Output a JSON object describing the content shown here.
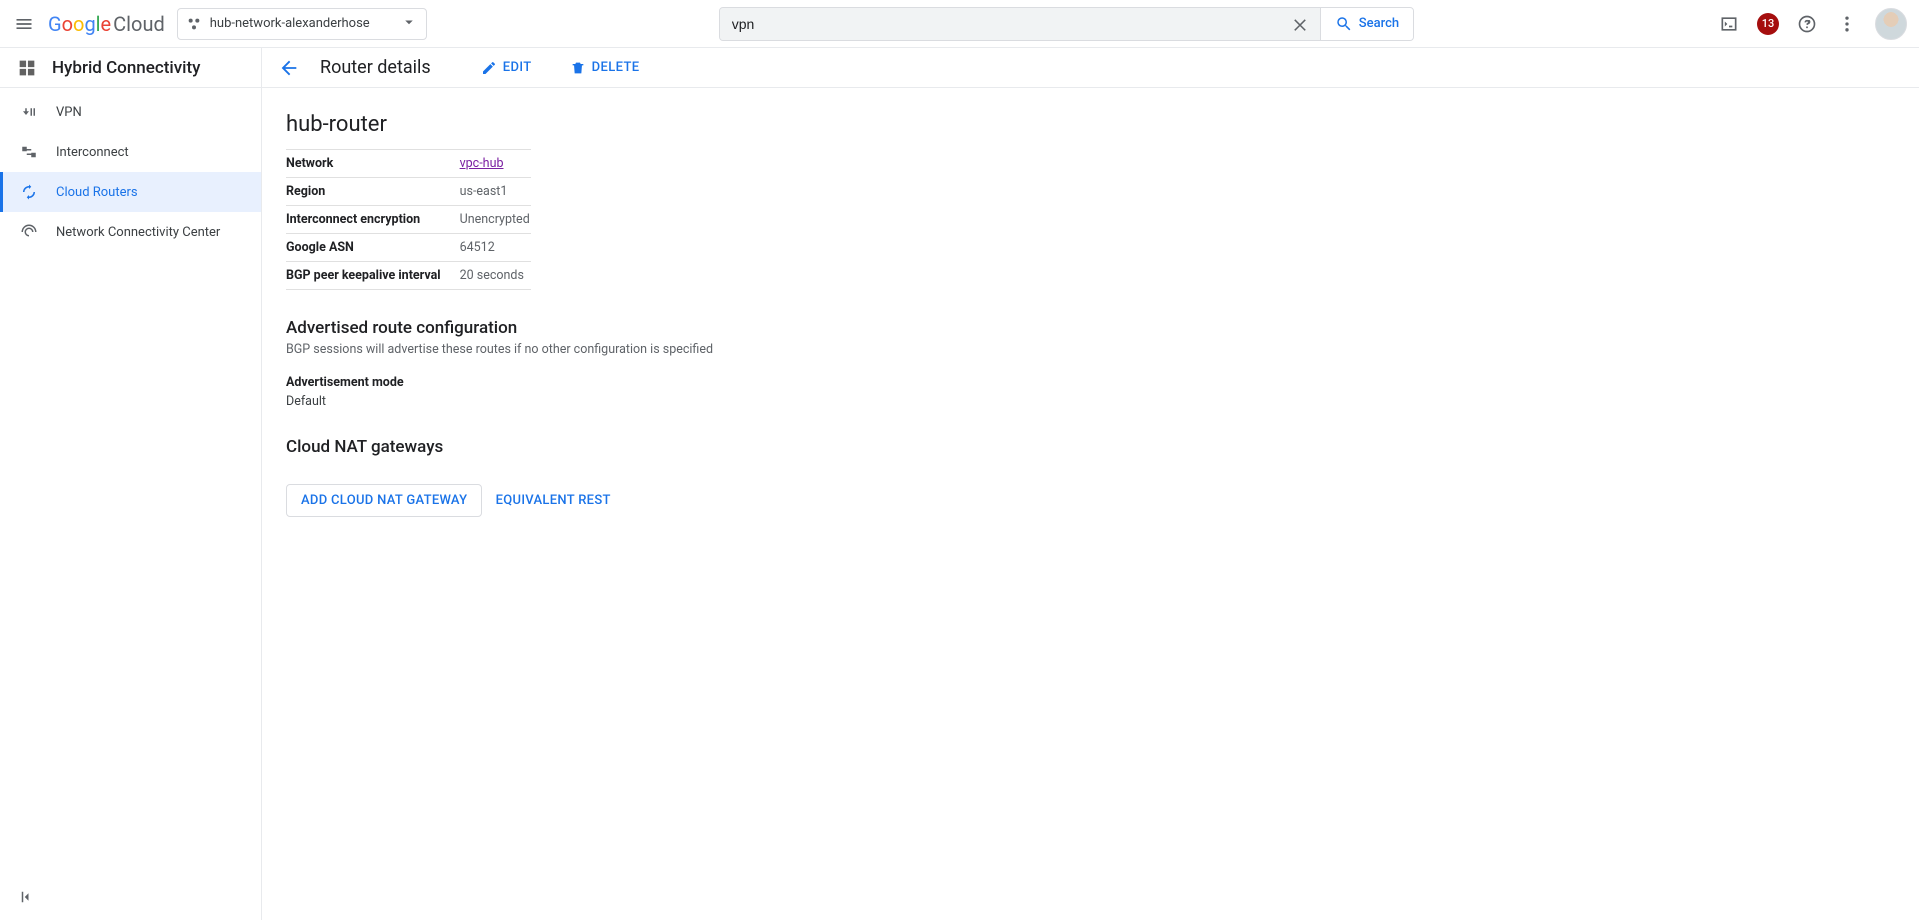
{
  "header": {
    "logo_cloud": "Cloud",
    "project_name": "hub-network-alexanderhose",
    "search_value": "vpn",
    "search_button": "Search",
    "notifications": "13"
  },
  "product": {
    "title": "Hybrid Connectivity"
  },
  "sidebar": {
    "items": [
      {
        "label": "VPN"
      },
      {
        "label": "Interconnect"
      },
      {
        "label": "Cloud Routers"
      },
      {
        "label": "Network Connectivity Center"
      }
    ]
  },
  "page": {
    "title": "Router details",
    "edit": "EDIT",
    "delete": "DELETE"
  },
  "router": {
    "name": "hub-router",
    "rows": [
      {
        "k": "Network",
        "v": "vpc-hub",
        "link": true
      },
      {
        "k": "Region",
        "v": "us-east1"
      },
      {
        "k": "Interconnect encryption",
        "v": "Unencrypted"
      },
      {
        "k": "Google ASN",
        "v": "64512"
      },
      {
        "k": "BGP peer keepalive interval",
        "v": "20 seconds"
      }
    ]
  },
  "adv": {
    "title": "Advertised route configuration",
    "desc": "BGP sessions will advertise these routes if no other configuration is specified",
    "mode_label": "Advertisement mode",
    "mode_value": "Default"
  },
  "nat": {
    "title": "Cloud NAT gateways",
    "add_btn": "ADD CLOUD NAT GATEWAY"
  },
  "footer": {
    "equivalent_rest": "EQUIVALENT REST"
  }
}
